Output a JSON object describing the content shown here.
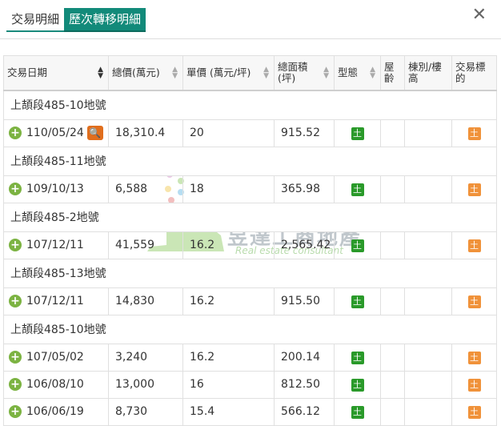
{
  "tabs": [
    {
      "label": "交易明細",
      "active": false
    },
    {
      "label": "歷次轉移明細",
      "active": true
    }
  ],
  "close_label": "✕",
  "table": {
    "headers": [
      {
        "label": "交易日期",
        "sort": "desc"
      },
      {
        "label": "總價(萬元)",
        "sort": "none"
      },
      {
        "label": "單價 (萬元/坪)",
        "sort": "none"
      },
      {
        "label": "總面積\n(坪)",
        "sort": "none"
      },
      {
        "label": "型態",
        "sort": "none"
      },
      {
        "label": "屋齡",
        "sort": ""
      },
      {
        "label": "棟別/樓高",
        "sort": ""
      },
      {
        "label": "交易標的",
        "sort": ""
      }
    ],
    "groups": [
      {
        "title": "上頡段485-10地號",
        "rows": [
          {
            "date": "110/05/24",
            "total": "18,310.4",
            "unit": "20",
            "area": "915.52",
            "type": "土",
            "target": "土",
            "detail_icon": true
          }
        ]
      },
      {
        "title": "上頡段485-11地號",
        "rows": [
          {
            "date": "109/10/13",
            "total": "6,588",
            "unit": "18",
            "area": "365.98",
            "type": "土",
            "target": "土",
            "detail_icon": false
          }
        ]
      },
      {
        "title": "上頡段485-2地號",
        "rows": [
          {
            "date": "107/12/11",
            "total": "41,559",
            "unit": "16.2",
            "area": "2,565.42",
            "type": "土",
            "target": "土",
            "detail_icon": false
          }
        ]
      },
      {
        "title": "上頡段485-13地號",
        "rows": [
          {
            "date": "107/12/11",
            "total": "14,830",
            "unit": "16.2",
            "area": "915.50",
            "type": "土",
            "target": "土",
            "detail_icon": false
          }
        ]
      },
      {
        "title": "上頡段485-10地號",
        "rows": [
          {
            "date": "107/05/02",
            "total": "3,240",
            "unit": "16.2",
            "area": "200.14",
            "type": "土",
            "target": "土",
            "detail_icon": false
          },
          {
            "date": "106/08/10",
            "total": "13,000",
            "unit": "16",
            "area": "812.50",
            "type": "土",
            "target": "土",
            "detail_icon": false
          },
          {
            "date": "106/06/19",
            "total": "8,730",
            "unit": "15.4",
            "area": "566.12",
            "type": "土",
            "target": "土",
            "detail_icon": false
          }
        ]
      }
    ]
  },
  "watermark": {
    "title": "昱達工商地產",
    "subtitle": "Real estate consultant"
  },
  "colors": {
    "accent": "#128a7a",
    "plus": "#7cb342",
    "type_badge": "#2a9a2a",
    "target_badge": "#f0923a",
    "detail_icon": "#e06e1d"
  },
  "icons": {
    "expand": "plus-circle-icon",
    "detail": "magnifier-icon",
    "close": "close-icon"
  }
}
